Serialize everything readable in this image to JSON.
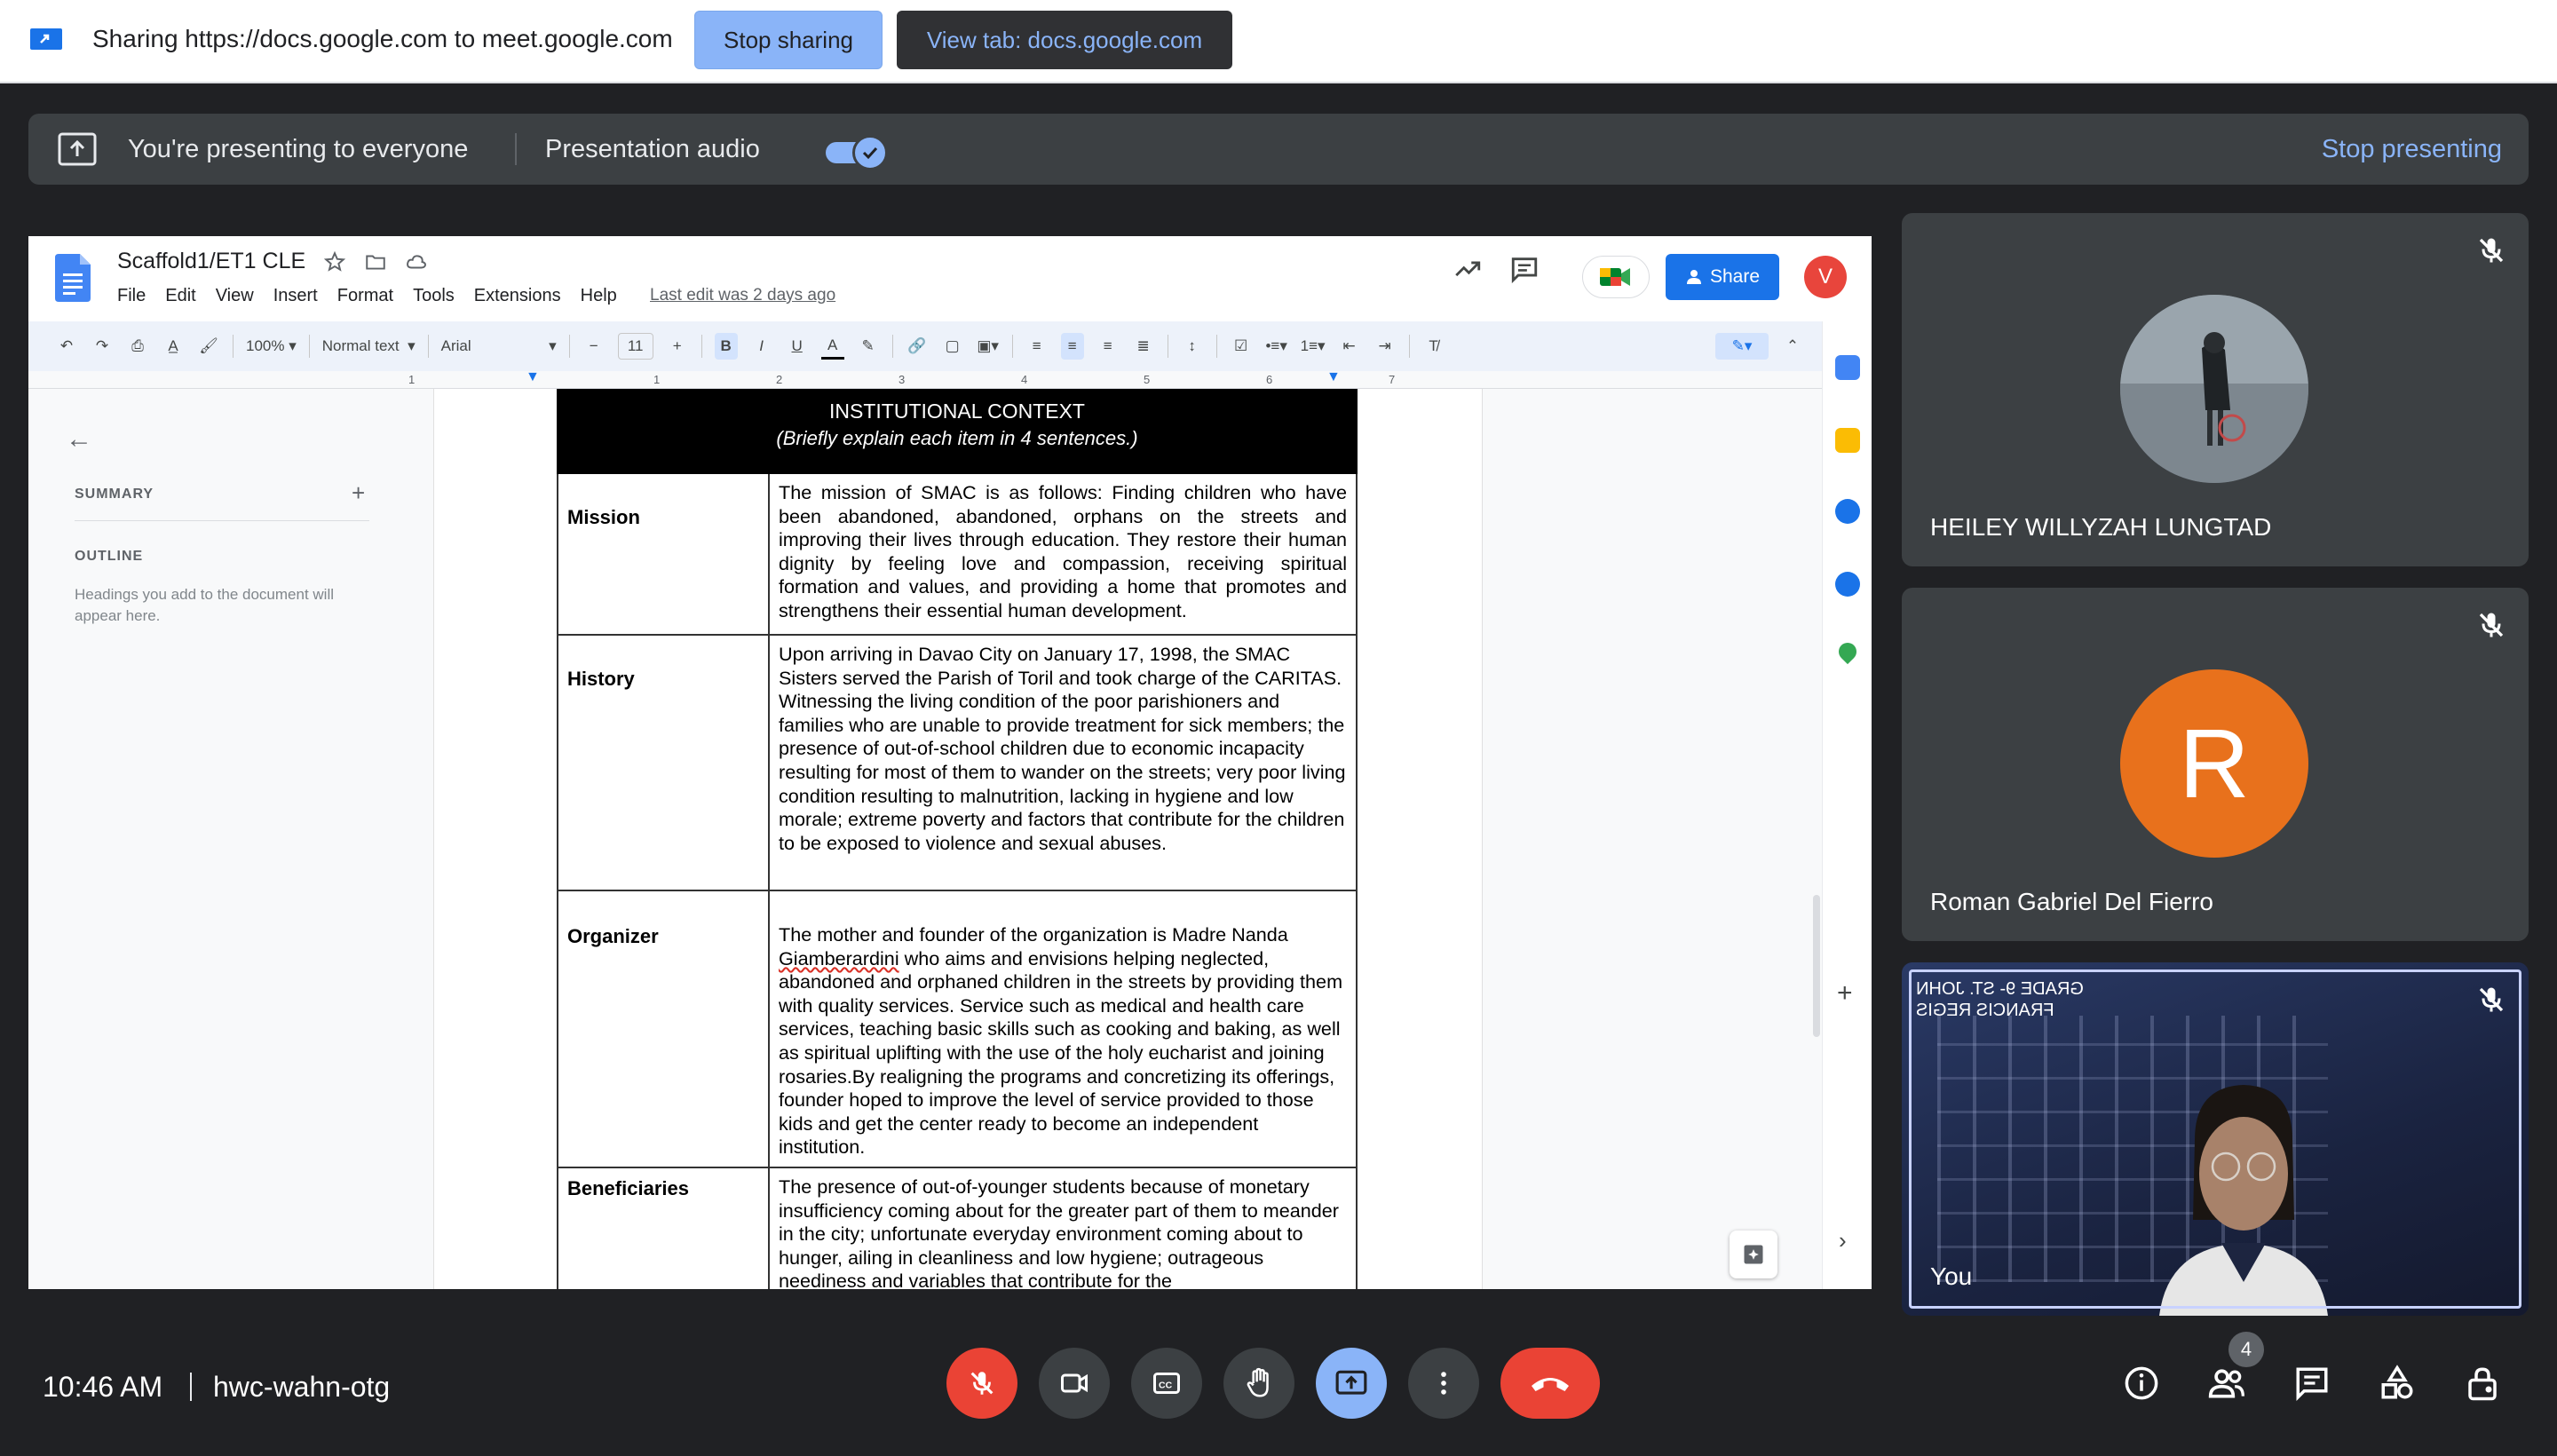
{
  "sharing_bar": {
    "text": "Sharing https://docs.google.com to meet.google.com",
    "stop_sharing": "Stop sharing",
    "view_tab": "View tab: docs.google.com"
  },
  "presenting_bar": {
    "text": "You're presenting to everyone",
    "audio_label": "Presentation audio",
    "audio_enabled": true,
    "stop_presenting": "Stop presenting"
  },
  "doc": {
    "title": "Scaffold1/ET1 CLE",
    "menu": [
      "File",
      "Edit",
      "View",
      "Insert",
      "Format",
      "Tools",
      "Extensions",
      "Help"
    ],
    "last_edit": "Last edit was 2 days ago",
    "share_label": "Share",
    "account_initial": "V",
    "toolbar": {
      "zoom": "100%",
      "style": "Normal text",
      "font": "Arial",
      "font_size": "11"
    },
    "ruler_marks": [
      "1",
      "1",
      "2",
      "3",
      "4",
      "5",
      "6",
      "7"
    ],
    "outline": {
      "summary": "SUMMARY",
      "outline": "OUTLINE",
      "hint": "Headings you add to the document will appear here."
    },
    "table": {
      "heading": "INSTITUTIONAL CONTEXT",
      "subheading": "(Briefly explain each item in 4 sentences.)",
      "rows": [
        {
          "label": "Mission",
          "text": "The mission of SMAC is as follows: Finding children who have been abandoned, abandoned, orphans on the streets and improving their lives through education. They restore their human dignity  by feeling love and compassion, receiving spiritual formation and values, and providing a home that promotes and strengthens their essential human development."
        },
        {
          "label": "History",
          "text": "Upon arriving in Davao City on January 17, 1998, the SMAC Sisters served the Parish of Toril and took charge of the CARITAS. Witnessing the living condition of the poor parishioners and families who are unable to provide treatment for sick members; the presence of out-of-school children due to economic incapacity resulting for most of them to wander on the streets; very poor living condition resulting to malnutrition, lacking in hygiene and low morale; extreme poverty and factors that contribute for the children to be exposed to violence and sexual abuses."
        },
        {
          "label": "Organizer",
          "text_before": "The mother and founder of the organization is Madre Nanda ",
          "text_flagged": "Giamberardini",
          "text_after": " who aims and envisions helping neglected, abandoned and orphaned children in the streets by providing them with quality services. Service such as medical and health care services, teaching basic skills such as cooking and baking, as well as spiritual uplifting with the use of the holy eucharist and joining rosaries.By realigning the programs and concretizing its offerings, founder  hoped to improve the level of service provided to those kids and get the center ready to become an independent institution."
        },
        {
          "label": "Beneficiaries",
          "text": "The presence of out-of-younger students because of monetary insufficiency coming about for the greater part of them to meander in the city; unfortunate everyday environment coming about to hunger, ailing in cleanliness and low hygiene; outrageous neediness and variables that contribute for the"
        }
      ]
    }
  },
  "participants": [
    {
      "name": "HEILEY WILLYZAH LUNGTAD",
      "muted": true,
      "avatar": "photo"
    },
    {
      "name": "Roman Gabriel Del Fierro",
      "muted": true,
      "avatar": "R",
      "avatar_color": "#e8711c"
    },
    {
      "name": "You",
      "muted": true,
      "avatar": "camera",
      "overlay_text": "GRADE 9- ST. JOHN FRANCIS REGIS"
    }
  ],
  "bottom_bar": {
    "time": "10:46 AM",
    "meeting_code": "hwc-wahn-otg",
    "participant_count": "4"
  }
}
